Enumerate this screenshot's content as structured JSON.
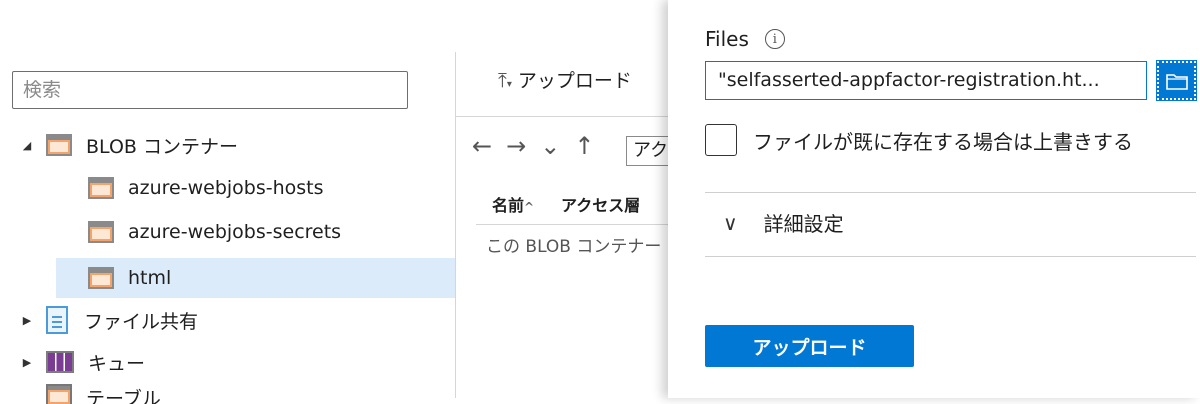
{
  "explorer": {
    "search_placeholder": "検索",
    "tree": {
      "blob_containers": "BLOB コンテナー",
      "containers": [
        "azure-webjobs-hosts",
        "azure-webjobs-secrets",
        "html"
      ],
      "file_shares": "ファイル共有",
      "queues": "キュー",
      "tables": "テーブル"
    }
  },
  "container_view": {
    "upload_label": "アップロード",
    "path_value": "アク",
    "columns": {
      "name": "名前",
      "access_tier": "アクセス層"
    },
    "empty_message": "この BLOB コンテナー"
  },
  "upload_pane": {
    "files_label": "Files",
    "info_glyph": "i",
    "file_value": "\"selfasserted-appfactor-registration.ht...",
    "overwrite_label": "ファイルが既に存在する場合は上書きする",
    "overwrite_checked": false,
    "advanced_label": "詳細設定",
    "upload_button": "アップロード"
  },
  "colors": {
    "accent": "#0078d4",
    "selected_row": "#dcebfa"
  }
}
